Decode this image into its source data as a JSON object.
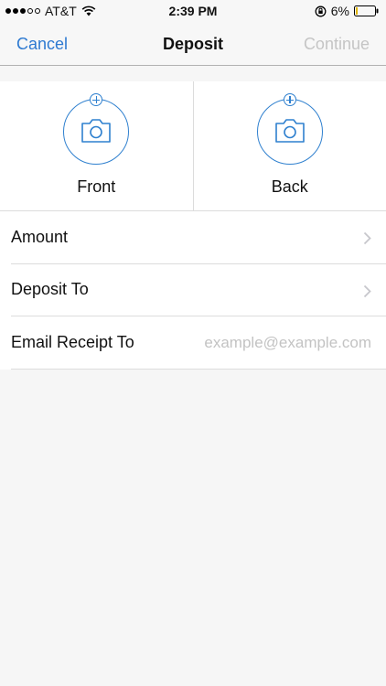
{
  "status": {
    "carrier": "AT&T",
    "time": "2:39 PM",
    "battery": "6%"
  },
  "nav": {
    "cancel": "Cancel",
    "title": "Deposit",
    "continue": "Continue"
  },
  "capture": {
    "front": "Front",
    "back": "Back"
  },
  "form": {
    "amount": "Amount",
    "deposit_to": "Deposit To",
    "email_label": "Email Receipt To",
    "email_placeholder": "example@example.com",
    "email_value": ""
  },
  "colors": {
    "accent": "#2e7ad1",
    "disabled": "#c5c5c5"
  }
}
